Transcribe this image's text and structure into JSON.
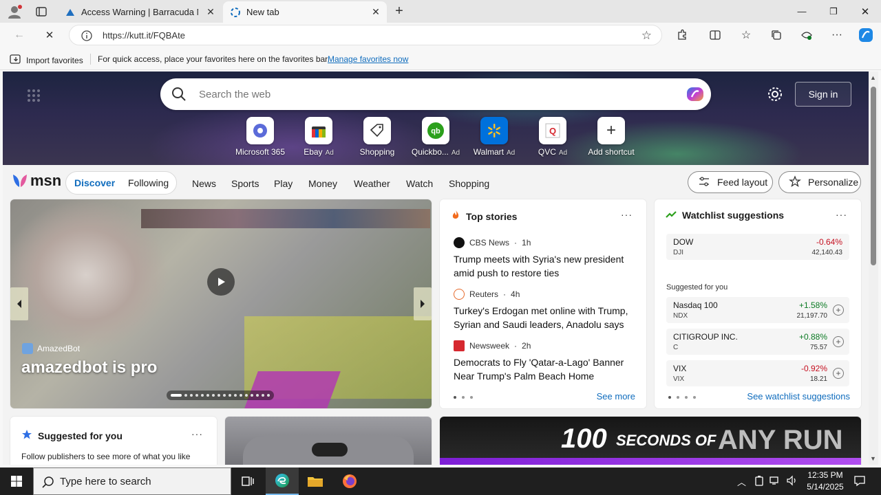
{
  "browser": {
    "tabs": [
      {
        "label": "Access Warning | Barracuda Netw",
        "active": false
      },
      {
        "label": "New tab",
        "active": true
      }
    ],
    "url": "https://kutt.it/FQBAte"
  },
  "favorites_bar": {
    "import_label": "Import favorites",
    "message": "For quick access, place your favorites here on the favorites bar.",
    "manage_link": "Manage favorites now"
  },
  "hero": {
    "search_placeholder": "Search the web",
    "sign_in": "Sign in",
    "shortcuts": [
      {
        "label": "Microsoft 365",
        "ad": ""
      },
      {
        "label": "Ebay",
        "ad": "Ad"
      },
      {
        "label": "Shopping",
        "ad": ""
      },
      {
        "label": "Quickbo...",
        "ad": "Ad"
      },
      {
        "label": "Walmart",
        "ad": "Ad"
      },
      {
        "label": "QVC",
        "ad": "Ad"
      },
      {
        "label": "Add shortcut",
        "ad": ""
      }
    ]
  },
  "msn": {
    "logo": "msn",
    "discover": "Discover",
    "following": "Following",
    "nav": [
      "News",
      "Sports",
      "Play",
      "Money",
      "Weather",
      "Watch",
      "Shopping"
    ],
    "feed_layout": "Feed layout",
    "personalize": "Personalize"
  },
  "video": {
    "source": "AmazedBot",
    "title": "amazedbot is pro"
  },
  "top_stories": {
    "title": "Top stories",
    "more": "···",
    "items": [
      {
        "publisher": "CBS News",
        "age": "1h",
        "headline": "Trump meets with Syria's new president amid push to restore ties"
      },
      {
        "publisher": "Reuters",
        "age": "4h",
        "headline": "Turkey's Erdogan met online with Trump, Syrian and Saudi leaders, Anadolu says"
      },
      {
        "publisher": "Newsweek",
        "age": "2h",
        "headline": "Democrats to Fly 'Qatar-a-Lago' Banner Near Trump's Palm Beach Home"
      }
    ],
    "see_more": "See more"
  },
  "watchlist": {
    "title": "Watchlist suggestions",
    "more": "···",
    "main": {
      "name": "DOW",
      "symbol": "DJI",
      "change": "-0.64%",
      "price": "42,140.43"
    },
    "suggested_label": "Suggested for you",
    "items": [
      {
        "name": "Nasdaq 100",
        "symbol": "NDX",
        "change": "+1.58%",
        "price": "21,197.70"
      },
      {
        "name": "CITIGROUP INC.",
        "symbol": "C",
        "change": "+0.88%",
        "price": "75.57"
      },
      {
        "name": "VIX",
        "symbol": "VIX",
        "change": "-0.92%",
        "price": "18.21"
      }
    ],
    "see_all": "See watchlist suggestions"
  },
  "suggested": {
    "title": "Suggested for you",
    "more": "···",
    "text": "Follow publishers to see more of what you like"
  },
  "promo": {
    "number": "100",
    "words": "SECONDS OF",
    "brand": "ANY RUN"
  },
  "taskbar": {
    "search_placeholder": "Type here to search",
    "time": "12:35 PM",
    "date": "5/14/2025"
  },
  "colors": {
    "accent": "#0f6cbd",
    "negative": "#c50f1f",
    "positive": "#0b7a23"
  }
}
